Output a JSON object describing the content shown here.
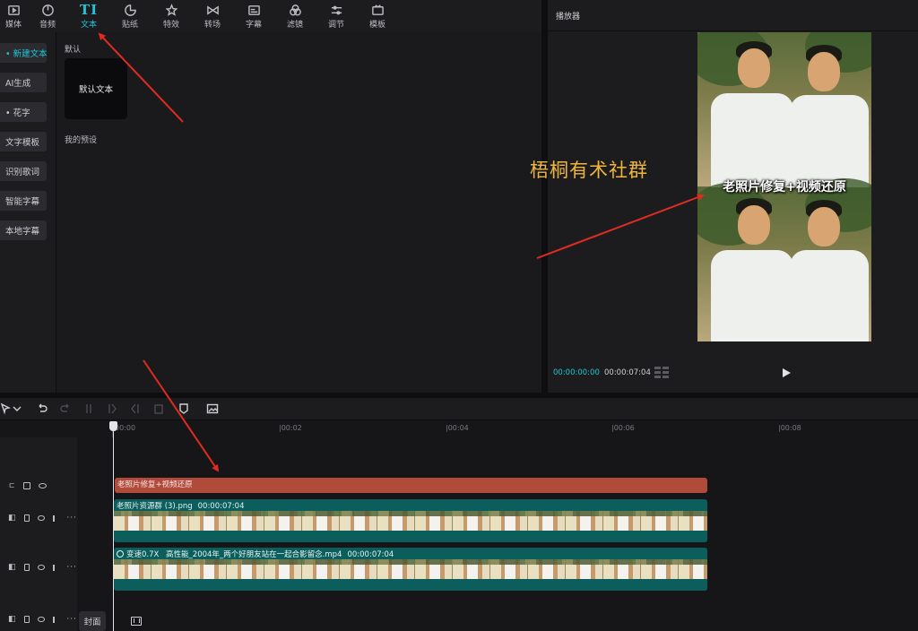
{
  "toolbar": {
    "items": [
      {
        "label": "媒体",
        "icon": "media-icon"
      },
      {
        "label": "音频",
        "icon": "audio-icon"
      },
      {
        "label": "文本",
        "icon": "text-icon",
        "glyph": "TI",
        "active": true
      },
      {
        "label": "贴纸",
        "icon": "sticker-icon"
      },
      {
        "label": "特效",
        "icon": "effects-icon"
      },
      {
        "label": "转场",
        "icon": "transition-icon"
      },
      {
        "label": "字幕",
        "icon": "subtitle-icon"
      },
      {
        "label": "滤镜",
        "icon": "filter-icon"
      },
      {
        "label": "调节",
        "icon": "adjust-icon"
      },
      {
        "label": "模板",
        "icon": "template-icon"
      }
    ]
  },
  "sidebar": {
    "items": [
      {
        "label": "• 新建文本",
        "active": true
      },
      {
        "label": "AI生成"
      },
      {
        "label": "• 花字"
      },
      {
        "label": "文字模板"
      },
      {
        "label": "识别歌词"
      },
      {
        "label": "智能字幕"
      },
      {
        "label": "本地字幕"
      }
    ]
  },
  "media": {
    "section_default": "默认",
    "default_tile": "默认文本",
    "section_presets": "我的预设"
  },
  "player": {
    "title": "播放器",
    "caption": "老照片修复+视频还原",
    "watermark": "梧桐有术社群",
    "time_current": "00:00:00:00",
    "time_total": "00:00:07:04"
  },
  "timeline": {
    "ruler": [
      "00:00",
      "|00:02",
      "|00:04",
      "|00:06",
      "|00:08"
    ],
    "text_clip": "老照片修复+视频还原",
    "image_clip": {
      "name": "老照片资源群 (3).png",
      "duration": "00:00:07:04"
    },
    "video_clip": {
      "speed": "变速0.7X",
      "name": "高性能_2004年_两个好朋友站在一起合影留念.mp4",
      "duration": "00:00:07:04"
    },
    "cover_label": "封面"
  },
  "colors": {
    "accent": "#1fc6d8",
    "text_clip": "#b04b3b",
    "video_clip": "#0b5e5c",
    "watermark": "#f0b73a",
    "arrow": "#e02b20"
  }
}
